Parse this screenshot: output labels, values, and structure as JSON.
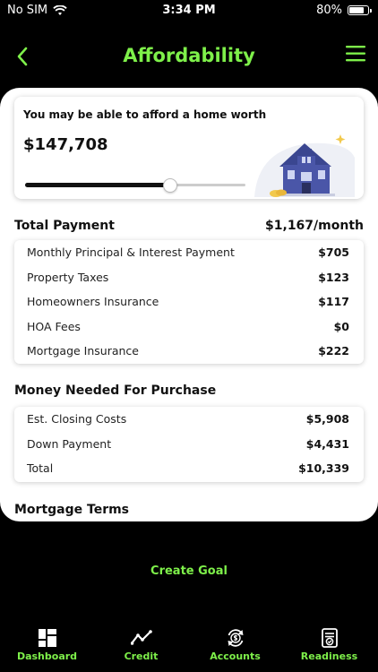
{
  "status": {
    "carrier": "No SIM",
    "time": "3:34 PM",
    "battery": "80%",
    "battery_level": 0.8
  },
  "header": {
    "title": "Affordability",
    "back_icon": "chevron-left-icon",
    "menu_icon": "hamburger-menu-icon"
  },
  "affordability": {
    "label": "You may be able to afford a home worth",
    "value": "$147,708",
    "slider_level": 0.66
  },
  "total_payment": {
    "label": "Total Payment",
    "amount": "$1,167/month",
    "rows": [
      {
        "label": "Monthly Principal & Interest Payment",
        "value": "$705"
      },
      {
        "label": "Property Taxes",
        "value": "$123"
      },
      {
        "label": "Homeowners Insurance",
        "value": "$117"
      },
      {
        "label": "HOA Fees",
        "value": "$0"
      },
      {
        "label": "Mortgage Insurance",
        "value": "$222"
      }
    ]
  },
  "money_needed": {
    "label": "Money Needed For Purchase",
    "rows": [
      {
        "label": "Est. Closing Costs",
        "value": "$5,908"
      },
      {
        "label": "Down Payment",
        "value": "$4,431"
      },
      {
        "label": "Total",
        "value": "$10,339"
      }
    ]
  },
  "mortgage_terms": {
    "label": "Mortgage Terms"
  },
  "create_goal_label": "Create Goal",
  "tabs": [
    {
      "label": "Dashboard",
      "icon": "dashboard-grid-icon"
    },
    {
      "label": "Credit",
      "icon": "trend-line-icon"
    },
    {
      "label": "Accounts",
      "icon": "dollar-refresh-icon"
    },
    {
      "label": "Readiness",
      "icon": "checklist-icon"
    }
  ],
  "colors": {
    "accent": "#7ef04a",
    "background": "#000000",
    "surface": "#ffffff",
    "house_blue": "#4a56a8"
  }
}
